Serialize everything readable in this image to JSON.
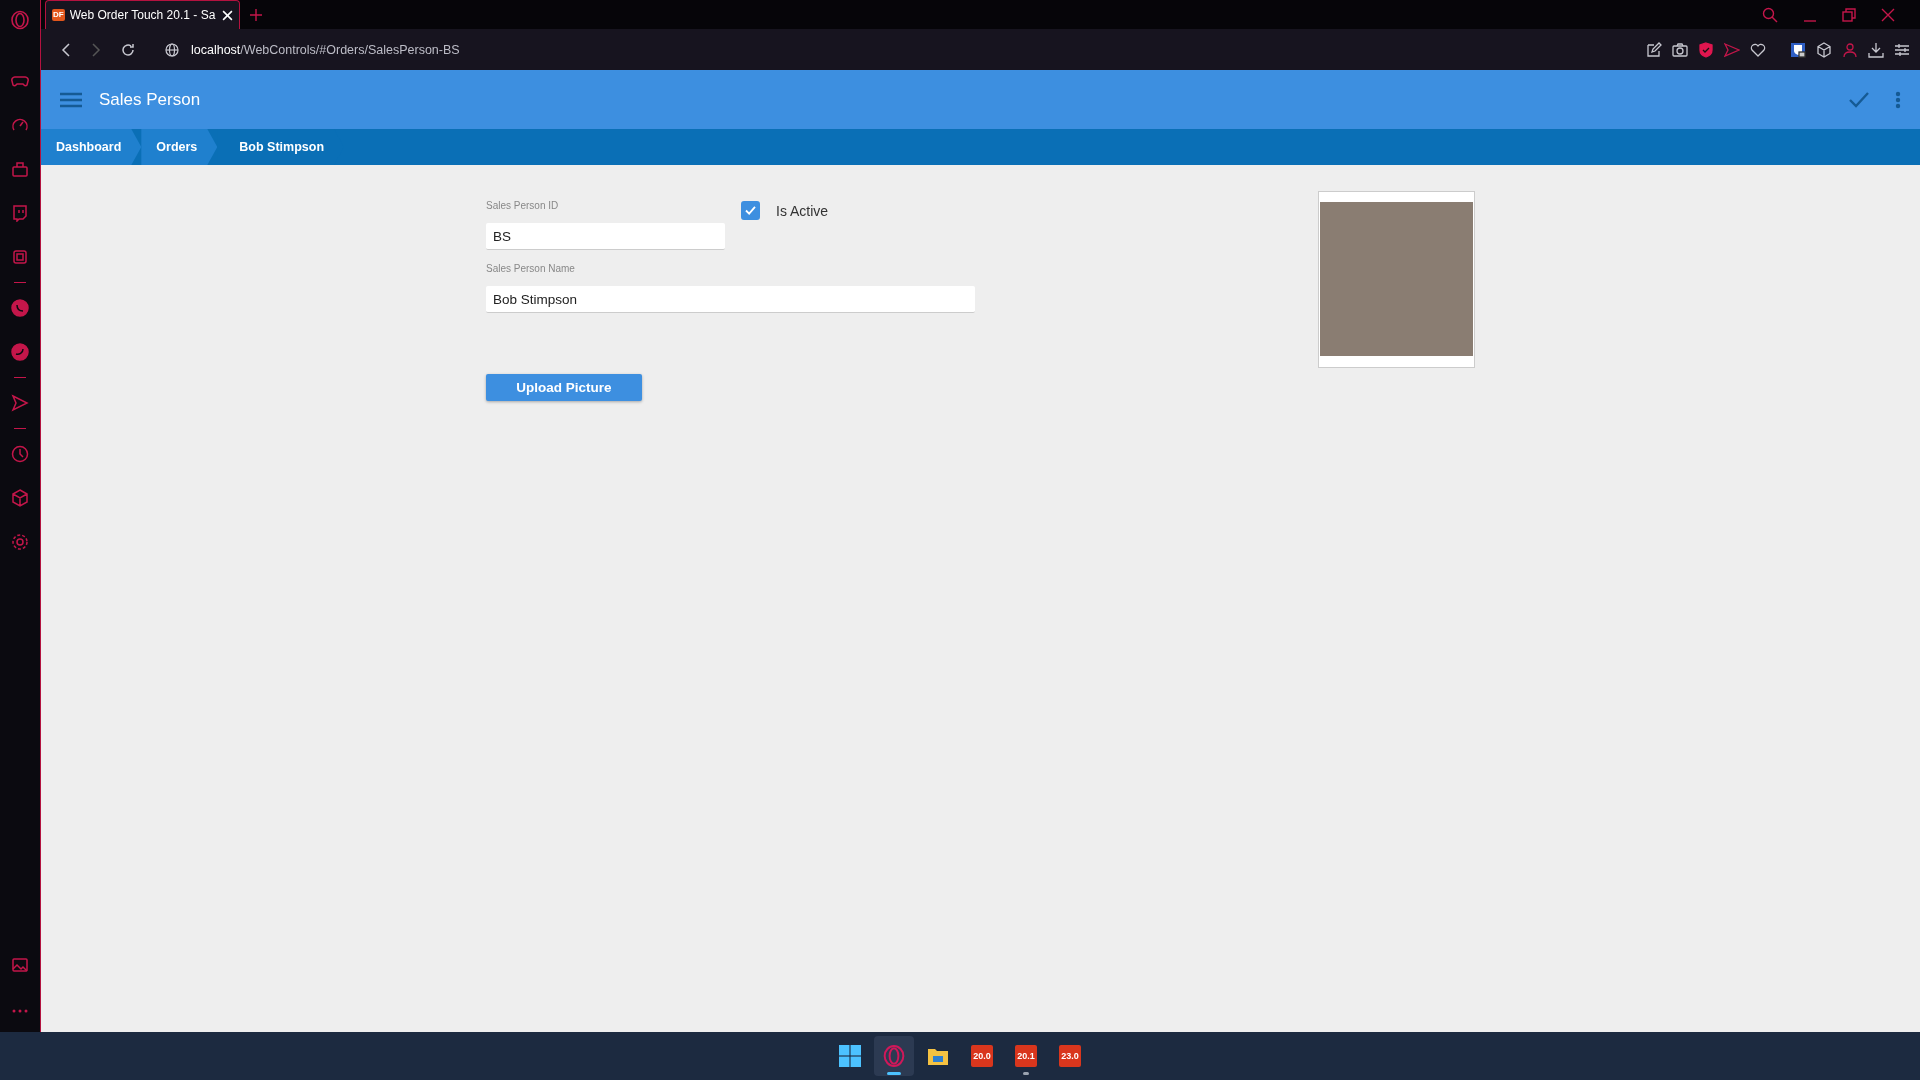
{
  "browser": {
    "tab": {
      "favicon": "DF",
      "title": "Web Order Touch 20.1 - Sa"
    },
    "address": {
      "host": "localhost",
      "path": "/WebControls/#Orders/SalesPerson-BS"
    }
  },
  "app_bar": {
    "title": "Sales Person"
  },
  "breadcrumbs": [
    {
      "label": "Dashboard",
      "current": false
    },
    {
      "label": "Orders",
      "current": false
    },
    {
      "label": "Bob Stimpson",
      "current": true
    }
  ],
  "form": {
    "id_field": {
      "label": "Sales Person ID",
      "value": "BS"
    },
    "is_active": {
      "label": "Is Active",
      "checked": true
    },
    "name_field": {
      "label": "Sales Person Name",
      "value": "Bob Stimpson"
    },
    "upload_button": "Upload Picture"
  },
  "taskbar": [
    {
      "kind": "start",
      "active": false,
      "running": false
    },
    {
      "kind": "browser",
      "active": true,
      "running": true
    },
    {
      "kind": "folder",
      "active": false,
      "running": false
    },
    {
      "kind": "app",
      "label": "20.0",
      "active": false,
      "running": false
    },
    {
      "kind": "app",
      "label": "20.1",
      "active": false,
      "running": true
    },
    {
      "kind": "app",
      "label": "23.0",
      "active": false,
      "running": false
    }
  ]
}
